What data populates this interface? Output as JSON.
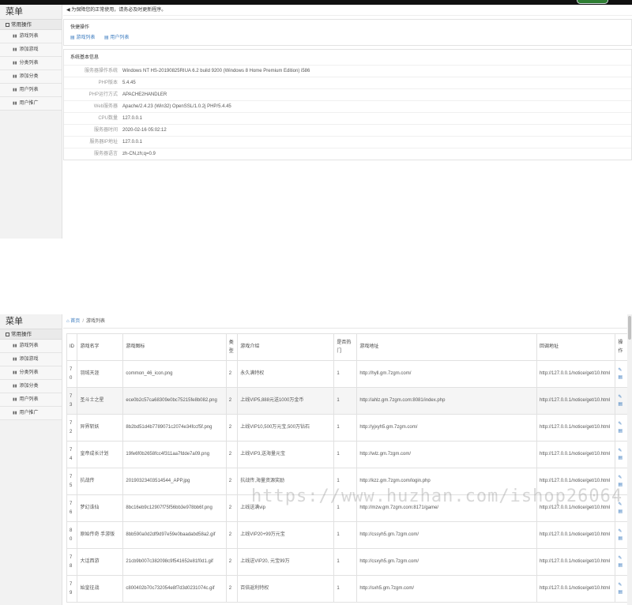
{
  "upper": {
    "sidebar": {
      "title": "菜单",
      "group": "常用操作",
      "items": [
        {
          "label": "游戏列表"
        },
        {
          "label": "添加游戏"
        },
        {
          "label": "分类列表"
        },
        {
          "label": "添加分类"
        },
        {
          "label": "用户列表"
        },
        {
          "label": "用户推广"
        }
      ]
    },
    "notice": "◀ 为保障您的正常使用，请务必及时更新程序。",
    "quick": {
      "title": "快捷操作",
      "links": [
        {
          "label": "▤ 游戏列表"
        },
        {
          "label": "▤ 用户列表"
        }
      ]
    },
    "sysinfo": {
      "title": "系统基本信息",
      "rows": [
        {
          "label": "服务器操作系统",
          "value": "Windows NT HS-20190825RIUA 6.2 build 9200 (Windows 8 Home Premium Edition) i586"
        },
        {
          "label": "PHP版本",
          "value": "5.4.45"
        },
        {
          "label": "PHP运行方式",
          "value": "APACHE2HANDLER"
        },
        {
          "label": "Web服务器",
          "value": "Apache/2.4.23 (Win32) OpenSSL/1.0.2j PHP/5.4.45"
        },
        {
          "label": "CPU数量",
          "value": "127.0.0.1"
        },
        {
          "label": "服务器时间",
          "value": "2020-02-16 05:02:12"
        },
        {
          "label": "服务器IP地址",
          "value": "127.0.0.1"
        },
        {
          "label": "服务器语言",
          "value": "zh-CN,zh;q=0.9"
        }
      ]
    }
  },
  "lower": {
    "sidebar": {
      "title": "菜单",
      "group": "常用操作",
      "items": [
        {
          "label": "游戏列表"
        },
        {
          "label": "添加游戏"
        },
        {
          "label": "分类列表"
        },
        {
          "label": "添加分类"
        },
        {
          "label": "用户列表"
        },
        {
          "label": "用户推广"
        }
      ]
    },
    "breadcrumb": {
      "home": "首页",
      "current": "游戏列表"
    },
    "table": {
      "headers": [
        "ID",
        "游戏名字",
        "游戏图标",
        "类型",
        "游戏介绍",
        "是否热门",
        "游戏地址",
        "回调地址",
        "操作"
      ],
      "rows": [
        {
          "id": "70",
          "name": "羽绒天涯",
          "icon": "common_46_icon.png",
          "type": "2",
          "intro": "永久满特权",
          "hot": "1",
          "url": "http://hyll.gm.7zgm.com/",
          "callback": "http://127.0.0.1/notice/get/10.html"
        },
        {
          "id": "73",
          "name": "圣斗士之星",
          "icon": "ece0b2c57ca68309e0bc75215fe8b082.png",
          "type": "2",
          "intro": "上线VIP5,888元送1000万金币",
          "hot": "1",
          "url": "http://ahlz.gm.7zgm.com:8081/index.php",
          "callback": "http://127.0.0.1/notice/get/10.html"
        },
        {
          "id": "72",
          "name": "异界斩妖",
          "icon": "8b2bd51d4b7789071c2074e34fccf5f.png",
          "type": "2",
          "intro": "上线VIP10,500万元宝,500万钻石",
          "hot": "1",
          "url": "http://yjxyh5.gm.7zgm.com/",
          "callback": "http://127.0.0.1/notice/get/10.html"
        },
        {
          "id": "74",
          "name": "皇帝成长计划",
          "icon": "19fe6f0b2658fcc4f311aa7fdde7a09.png",
          "type": "2",
          "intro": "上线VIP3,送海量元宝",
          "hot": "1",
          "url": "http://wlz.gm.7zgm.com/",
          "callback": "http://127.0.0.1/notice/get/10.html"
        },
        {
          "id": "75",
          "name": "抗战传",
          "icon": "20190323403514544_APP.jpg",
          "type": "2",
          "intro": "抗战传,海量资源奖励",
          "hot": "1",
          "url": "http://kzz.gm.7zgm.com/login.php",
          "callback": "http://127.0.0.1/notice/get/10.html"
        },
        {
          "id": "76",
          "name": "梦幻诛仙",
          "icon": "8bc16eb9c12907f75f56bb3e978bb6f.png",
          "type": "2",
          "intro": "上线送满vip",
          "hot": "1",
          "url": "http://mzw.gm.7zgm.com:8171/game/",
          "callback": "http://127.0.0.1/notice/get/10.html"
        },
        {
          "id": "80",
          "name": "原始传奇 手游版",
          "icon": "8bb590a0d2df9d97e59e0baadabd58a2.gif",
          "type": "2",
          "intro": "上线VIP20+99万元宝",
          "hot": "1",
          "url": "http://cssyh5.gm.7zgm.com/",
          "callback": "http://127.0.0.1/notice/get/10.html"
        },
        {
          "id": "78",
          "name": "大话西游",
          "icon": "21cb9b007c382098c9f541652e81f0d1.gif",
          "type": "2",
          "intro": "上线送VIP20, 元宝99万",
          "hot": "1",
          "url": "http://csxyh5.gm.7zgm.com/",
          "callback": "http://127.0.0.1/notice/get/10.html"
        },
        {
          "id": "79",
          "name": "始皇征战",
          "icon": "c800402b70c732054e8f7d3d0231074c.gif",
          "type": "2",
          "intro": "百倍返利特权",
          "hot": "1",
          "url": "http://sxh5.gm.7zgm.com/",
          "callback": "http://127.0.0.1/notice/get/10.html"
        }
      ],
      "actions": [
        "✎",
        "▤"
      ]
    }
  },
  "watermark": "https://www.huzhan.com/ishop26064"
}
